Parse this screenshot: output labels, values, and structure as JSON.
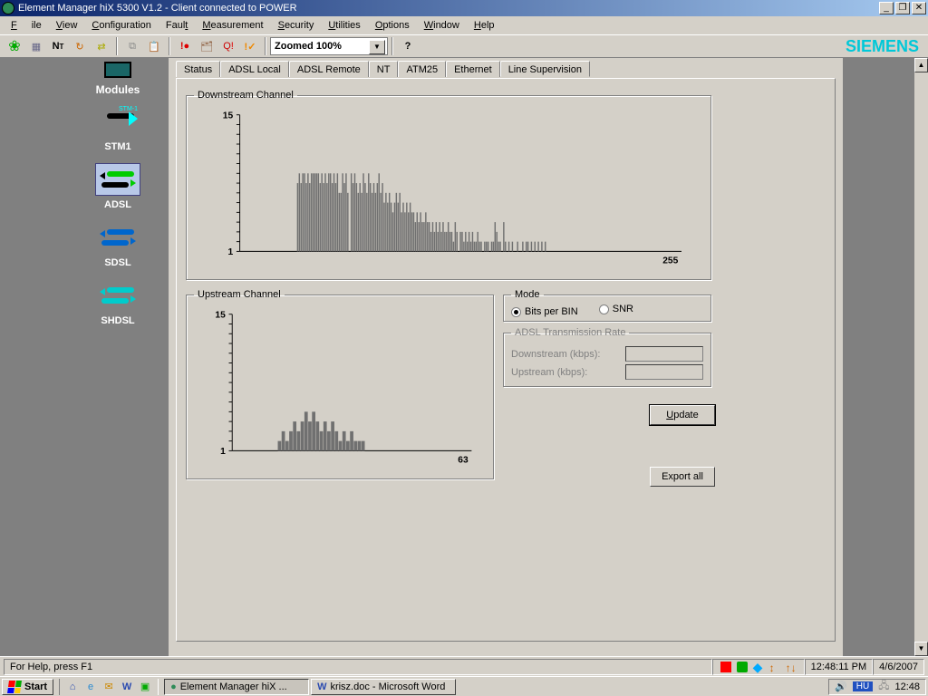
{
  "title": "Element Manager hiX 5300 V1.2 - Client connected to POWER",
  "menu": {
    "file": "File",
    "view": "View",
    "config": "Configuration",
    "fault": "Fault",
    "meas": "Measurement",
    "sec": "Security",
    "util": "Utilities",
    "opt": "Options",
    "win": "Window",
    "help": "Help"
  },
  "toolbar": {
    "zoom": "Zoomed 100%",
    "brand": "SIEMENS"
  },
  "sidebar": {
    "header": "Modules",
    "items": [
      {
        "id": "stm1",
        "label": "STM1"
      },
      {
        "id": "adsl",
        "label": "ADSL"
      },
      {
        "id": "sdsl",
        "label": "SDSL"
      },
      {
        "id": "shdsl",
        "label": "SHDSL"
      }
    ],
    "selected": "adsl"
  },
  "tabs": [
    "Status",
    "ADSL Local",
    "ADSL Remote",
    "NT",
    "ATM25",
    "Ethernet",
    "Line Supervision"
  ],
  "active_tab": "Line Supervision",
  "groups": {
    "downstream": "Downstream Channel",
    "upstream": "Upstream Channel",
    "mode": "Mode",
    "rate": "ADSL Transmission Rate"
  },
  "mode": {
    "bits": "Bits per BIN",
    "snr": "SNR",
    "selected": "bits"
  },
  "rate": {
    "down_label": "Downstream (kbps):",
    "up_label": "Upstream (kbps):",
    "down": "",
    "up": ""
  },
  "buttons": {
    "update": "Update",
    "export": "Export all"
  },
  "statusbar": {
    "help": "For Help, press F1",
    "time": "12:48:11 PM",
    "date": "4/6/2007"
  },
  "taskbar": {
    "start": "Start",
    "tasks": [
      {
        "label": "Element Manager hiX ...",
        "active": true,
        "icon": "●",
        "iconcolor": "#2e8b57"
      },
      {
        "label": "krisz.doc - Microsoft Word",
        "active": false,
        "icon": "W",
        "iconcolor": "#2a4ab0"
      }
    ],
    "lang": "HU",
    "clock": "12:48"
  },
  "chart_data": [
    {
      "name": "downstream",
      "type": "bar",
      "title": "Downstream Channel",
      "xmax": 255,
      "ylim": [
        1,
        15
      ],
      "yticks": [
        1,
        15
      ],
      "start_bin": 33,
      "values": [
        8,
        9,
        8,
        9,
        9,
        8,
        9,
        8,
        9,
        9,
        9,
        9,
        9,
        8,
        9,
        8,
        9,
        8,
        9,
        9,
        8,
        9,
        8,
        9,
        7,
        7,
        9,
        8,
        9,
        7,
        0,
        9,
        8,
        9,
        8,
        7,
        8,
        7,
        9,
        8,
        7,
        9,
        8,
        7,
        8,
        7,
        8,
        9,
        7,
        8,
        6,
        7,
        6,
        7,
        6,
        5,
        6,
        7,
        6,
        7,
        5,
        6,
        5,
        6,
        5,
        6,
        5,
        5,
        4,
        5,
        4,
        5,
        4,
        4,
        5,
        4,
        4,
        3,
        4,
        3,
        4,
        3,
        4,
        3,
        4,
        3,
        3,
        4,
        3,
        3,
        2,
        4,
        3,
        0,
        3,
        3,
        2,
        3,
        2,
        3,
        2,
        3,
        2,
        2,
        3,
        2,
        2,
        0,
        2,
        2,
        2,
        0,
        2,
        2,
        4,
        3,
        2,
        2,
        0,
        4,
        2,
        0,
        2,
        0,
        2,
        0,
        0,
        2,
        0,
        0,
        2,
        0,
        2,
        2,
        0,
        2,
        0,
        2,
        0,
        2,
        0,
        2,
        0,
        2
      ]
    },
    {
      "name": "upstream",
      "type": "bar",
      "title": "Upstream Channel",
      "xmax": 63,
      "ylim": [
        1,
        15
      ],
      "yticks": [
        1,
        15
      ],
      "start_bin": 12,
      "values": [
        2,
        3,
        2,
        3,
        4,
        3,
        4,
        5,
        4,
        5,
        4,
        3,
        4,
        3,
        4,
        3,
        2,
        3,
        2,
        3,
        2,
        2,
        2
      ]
    }
  ]
}
